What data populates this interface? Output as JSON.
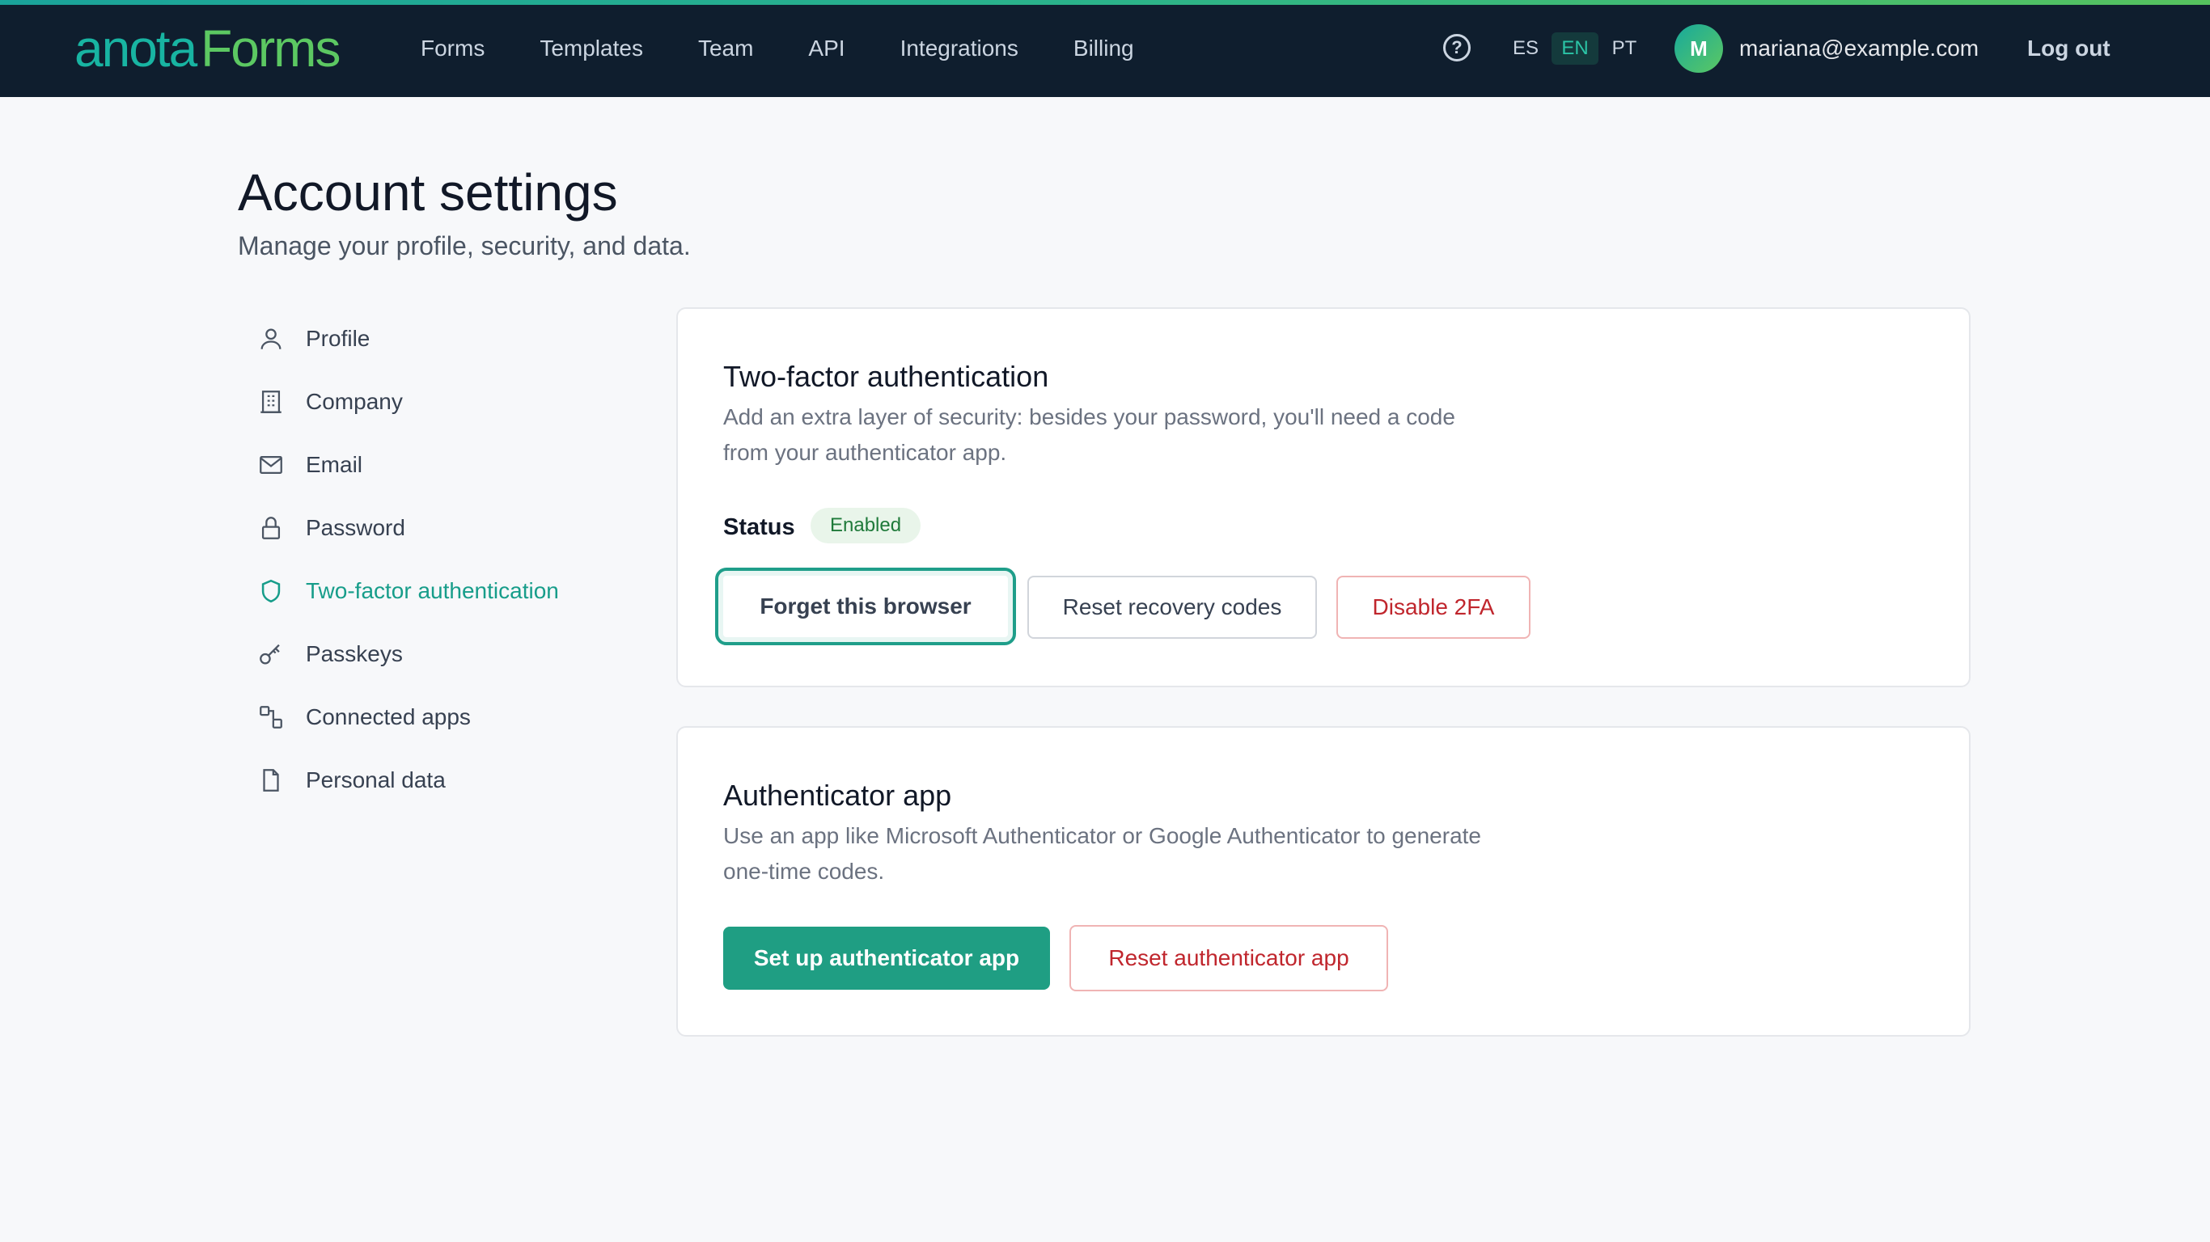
{
  "brand": {
    "logo_word1": "anota",
    "logo_word2": "Forms",
    "accent_color": "#1f9e83",
    "danger_color": "#c0262d"
  },
  "nav": {
    "items": [
      "Forms",
      "Templates",
      "Team",
      "API",
      "Integrations",
      "Billing"
    ],
    "help_icon": "?",
    "languages": [
      {
        "code": "ES",
        "selected": false
      },
      {
        "code": "EN",
        "selected": true
      },
      {
        "code": "PT",
        "selected": false
      }
    ],
    "avatar_initial": "M",
    "user_email": "mariana@example.com",
    "logout_label": "Log out"
  },
  "page": {
    "title": "Account settings",
    "subtitle": "Manage your profile, security, and data."
  },
  "sidebar": {
    "items": [
      {
        "label": "Profile",
        "icon": "user-icon",
        "active": false
      },
      {
        "label": "Company",
        "icon": "building-icon",
        "active": false
      },
      {
        "label": "Email",
        "icon": "mail-icon",
        "active": false
      },
      {
        "label": "Password",
        "icon": "lock-icon",
        "active": false
      },
      {
        "label": "Two-factor authentication",
        "icon": "shield-icon",
        "active": true
      },
      {
        "label": "Passkeys",
        "icon": "key-icon",
        "active": false
      },
      {
        "label": "Connected apps",
        "icon": "connected-apps-icon",
        "active": false
      },
      {
        "label": "Personal data",
        "icon": "file-icon",
        "active": false
      }
    ]
  },
  "two_factor": {
    "title": "Two-factor authentication",
    "description": "Add an extra layer of security: besides your password, you'll need a code from your authenticator app.",
    "status_label": "Status",
    "status_value": "Enabled",
    "buttons": {
      "forget_browser": "Forget this browser",
      "reset_recovery": "Reset recovery codes",
      "disable": "Disable 2FA"
    }
  },
  "authenticator": {
    "title": "Authenticator app",
    "description": "Use an app like Microsoft Authenticator or Google Authenticator to generate one-time codes.",
    "buttons": {
      "setup": "Set up authenticator app",
      "reset": "Reset authenticator app"
    }
  }
}
